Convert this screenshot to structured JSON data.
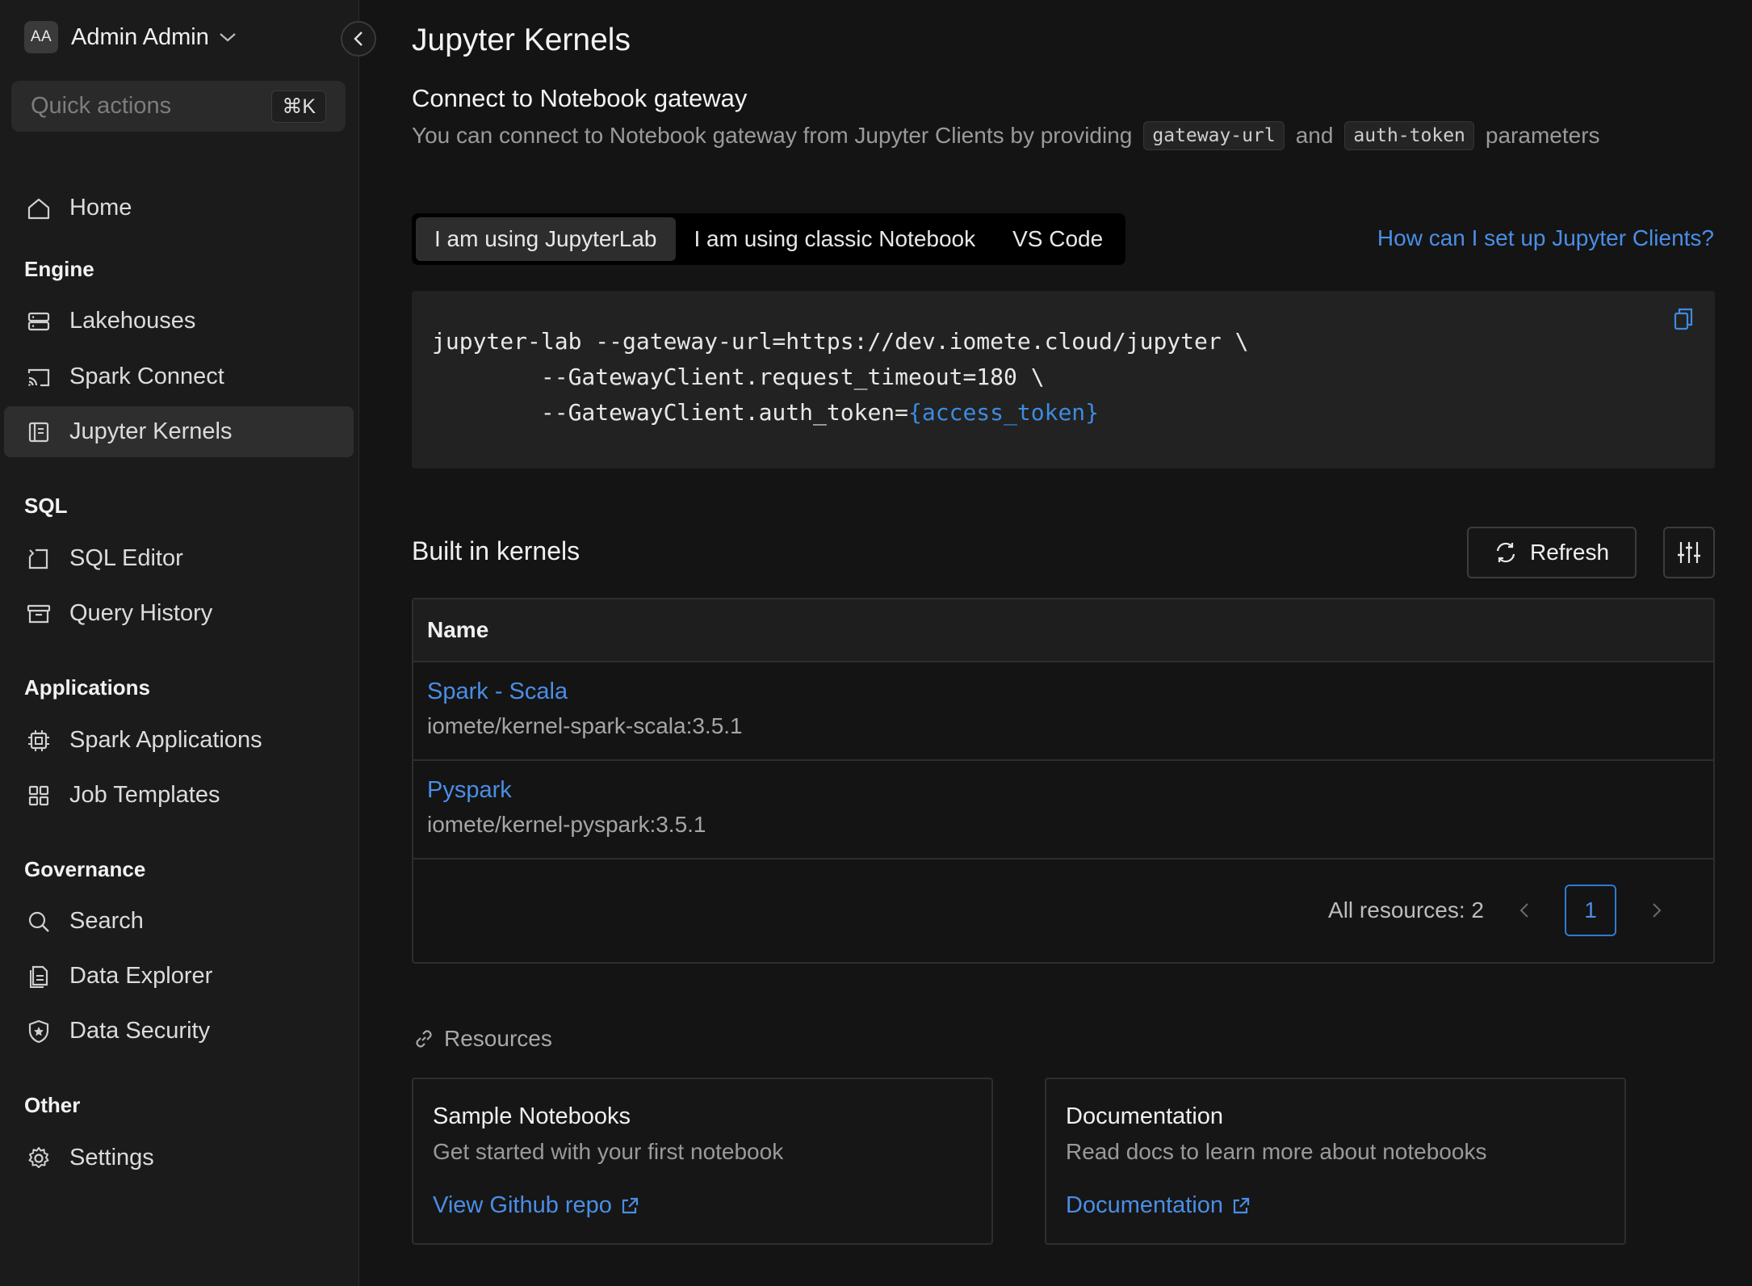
{
  "user": {
    "initials": "AA",
    "name": "Admin Admin"
  },
  "quick_actions": {
    "placeholder": "Quick actions",
    "shortcut": "⌘K"
  },
  "nav": {
    "home": "Home",
    "engine": {
      "title": "Engine",
      "lakehouses": "Lakehouses",
      "spark_connect": "Spark Connect",
      "jupyter_kernels": "Jupyter Kernels"
    },
    "sql": {
      "title": "SQL",
      "sql_editor": "SQL Editor",
      "query_history": "Query History"
    },
    "applications": {
      "title": "Applications",
      "spark_applications": "Spark Applications",
      "job_templates": "Job Templates"
    },
    "governance": {
      "title": "Governance",
      "search": "Search",
      "data_explorer": "Data Explorer",
      "data_security": "Data Security"
    },
    "other": {
      "title": "Other",
      "settings": "Settings"
    }
  },
  "page": {
    "title": "Jupyter Kernels",
    "connect_title": "Connect to Notebook gateway",
    "connect_desc_1": "You can connect to Notebook gateway from Jupyter Clients by providing",
    "param_1": "gateway-url",
    "connect_desc_and": "and",
    "param_2": "auth-token",
    "connect_desc_2": "parameters"
  },
  "tabs": [
    "I am using JupyterLab",
    "I am using classic Notebook",
    "VS Code"
  ],
  "help_link": "How can I set up Jupyter Clients?",
  "code": {
    "line1": "jupyter-lab --gateway-url=https://dev.iomete.cloud/jupyter \\",
    "line2": "        --GatewayClient.request_timeout=180 \\",
    "line3": "        --GatewayClient.auth_token=",
    "token": "{access_token}"
  },
  "kernels": {
    "title": "Built in kernels",
    "refresh_label": "Refresh",
    "column_name": "Name",
    "rows": [
      {
        "name": "Spark - Scala",
        "image": "iomete/kernel-spark-scala:3.5.1"
      },
      {
        "name": "Pyspark",
        "image": "iomete/kernel-pyspark:3.5.1"
      }
    ],
    "total_label": "All resources: 2",
    "current_page": "1"
  },
  "resources": {
    "title": "Resources",
    "cards": [
      {
        "title": "Sample Notebooks",
        "desc": "Get started with your first notebook",
        "link": "View Github repo"
      },
      {
        "title": "Documentation",
        "desc": "Read docs to learn more about notebooks",
        "link": "Documentation"
      }
    ]
  },
  "colors": {
    "accent": "#4a8ee6",
    "background": "#141414",
    "sidebar": "#1b1b1b"
  }
}
